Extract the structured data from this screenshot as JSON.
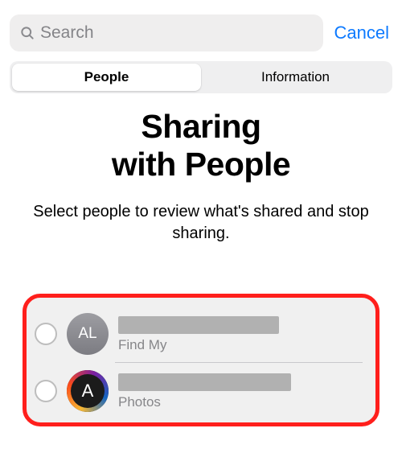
{
  "topbar": {
    "search_placeholder": "Search",
    "cancel": "Cancel"
  },
  "segmented": {
    "people": "People",
    "information": "Information",
    "active": "people"
  },
  "heading": {
    "line1": "Sharing",
    "line2": "with People",
    "subtitle": "Select people to review what's shared and stop sharing."
  },
  "people": [
    {
      "initials": "AL",
      "name_redacted": true,
      "app": "Find My",
      "avatar_style": "gray"
    },
    {
      "initials": "A",
      "name_redacted": true,
      "app": "Photos",
      "avatar_style": "ringed"
    }
  ]
}
